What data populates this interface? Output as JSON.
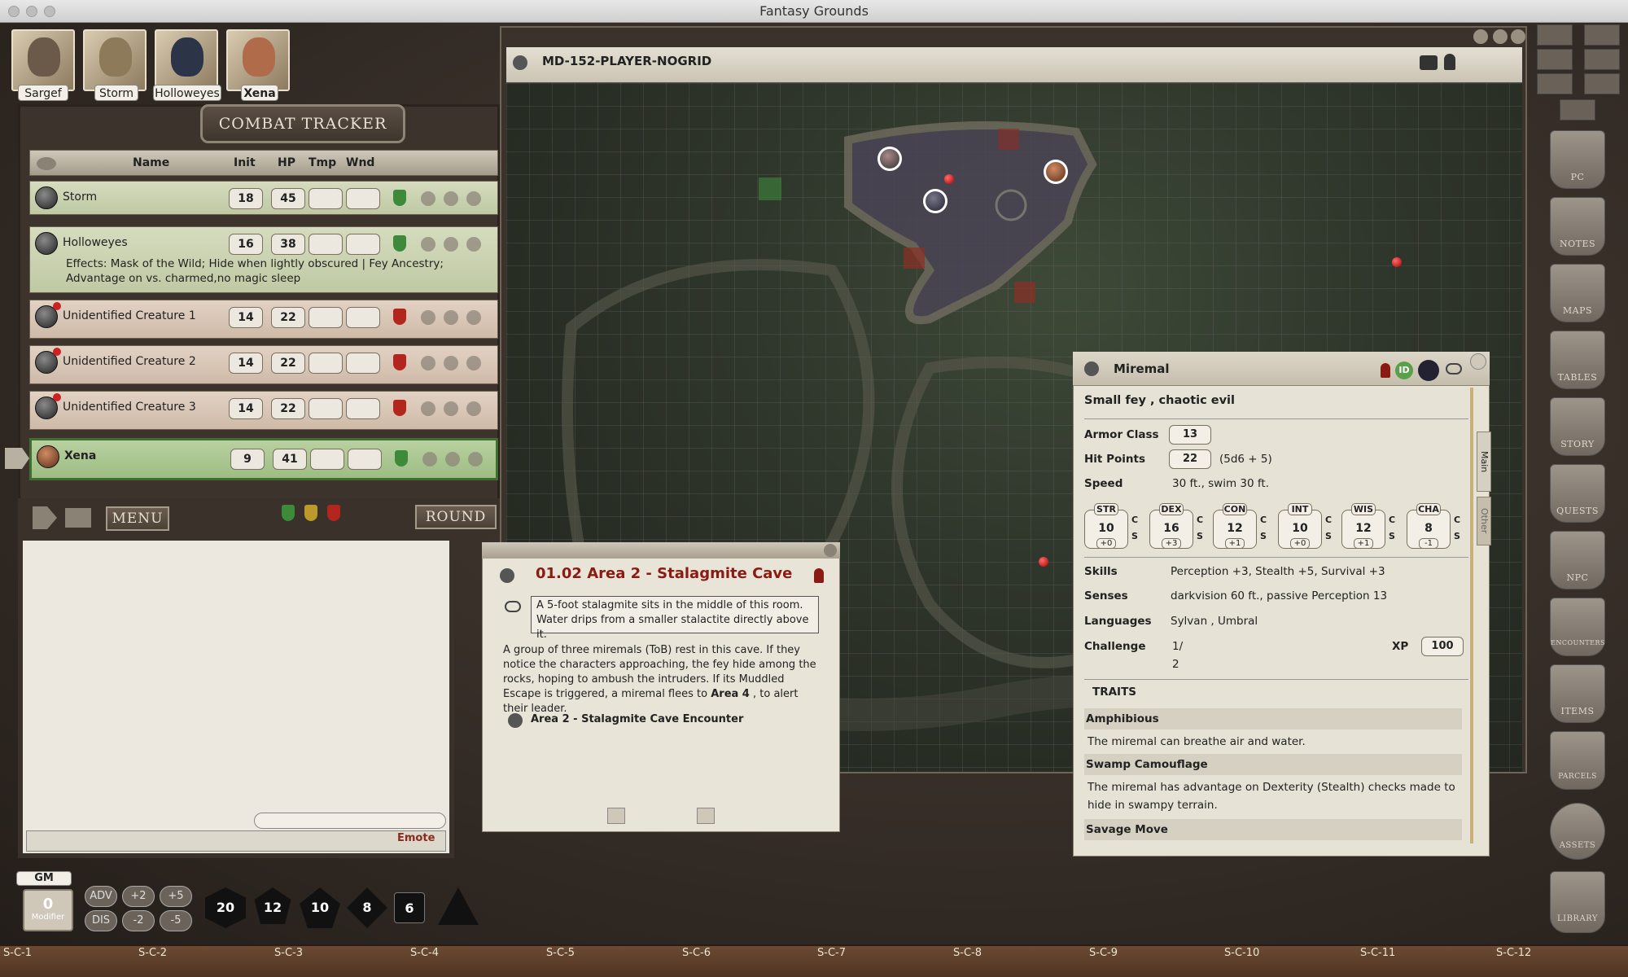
{
  "app": {
    "title": "Fantasy Grounds"
  },
  "portraits": [
    {
      "name": "Sargef"
    },
    {
      "name": "Storm"
    },
    {
      "name": "Holloweyes"
    },
    {
      "name": "Xena"
    }
  ],
  "combat_tracker": {
    "title": "COMBAT TRACKER",
    "headers": {
      "name": "Name",
      "init": "Init",
      "hp": "HP",
      "tmp": "Tmp",
      "wnd": "Wnd"
    },
    "rows": [
      {
        "name": "Storm",
        "init": "18",
        "hp": "45",
        "faction": "friend"
      },
      {
        "name": "Holloweyes",
        "init": "16",
        "hp": "38",
        "faction": "friend",
        "effects": "Effects: Mask of the Wild; Hide when lightly obscured | Fey Ancestry; Advantage on vs. charmed,no magic sleep"
      },
      {
        "name": "Unidentified Creature 1",
        "init": "14",
        "hp": "22",
        "faction": "foe"
      },
      {
        "name": "Unidentified Creature 2",
        "init": "14",
        "hp": "22",
        "faction": "foe"
      },
      {
        "name": "Unidentified Creature 3",
        "init": "14",
        "hp": "22",
        "faction": "foe"
      },
      {
        "name": "Xena",
        "init": "9",
        "hp": "41",
        "faction": "friend",
        "active": true
      }
    ],
    "menu_label": "MENU",
    "round_label": "ROUND"
  },
  "chat": {
    "emote_label": "Emote"
  },
  "dice_bar": {
    "gm_label": "GM",
    "modifier_value": "0",
    "modifier_label": "Modifier",
    "buttons": [
      "ADV",
      "+2",
      "+5",
      "DIS",
      "-2",
      "-5"
    ],
    "dice": [
      "20",
      "12",
      "10",
      "8",
      "6"
    ]
  },
  "map": {
    "title": "MD-152-PLAYER-NOGRID"
  },
  "story": {
    "title": "01.02 Area 2 - Stalagmite Cave",
    "boxed_text": "A 5-foot stalagmite sits in the middle of this room. Water drips from a smaller stalactite directly above it.",
    "body_1": "A group of three miremals (ToB) rest in this cave. If they notice the characters approaching, the fey hide among the rocks, hoping to ambush the intruders. If its Muddled Escape is triggered, a miremal flees to ",
    "body_bold": "Area 4",
    "body_2": " , to alert their leader.",
    "link": "Area 2 - Stalagmite Cave Encounter"
  },
  "npc": {
    "name": "Miremal",
    "type": "Small fey , chaotic evil",
    "armor_class_label": "Armor Class",
    "armor_class": "13",
    "hit_points_label": "Hit Points",
    "hit_points": "22",
    "hit_dice": "(5d6 + 5)",
    "speed_label": "Speed",
    "speed": "30 ft., swim 30 ft.",
    "abilities": [
      {
        "name": "STR",
        "value": "10",
        "mod": "+0"
      },
      {
        "name": "DEX",
        "value": "16",
        "mod": "+3"
      },
      {
        "name": "CON",
        "value": "12",
        "mod": "+1"
      },
      {
        "name": "INT",
        "value": "10",
        "mod": "+0"
      },
      {
        "name": "WIS",
        "value": "12",
        "mod": "+1"
      },
      {
        "name": "CHA",
        "value": "8",
        "mod": "-1"
      }
    ],
    "save_c": "C",
    "save_s": "S",
    "skills_label": "Skills",
    "skills": "Perception +3, Stealth +5, Survival +3",
    "senses_label": "Senses",
    "senses": "darkvision 60 ft., passive Perception 13",
    "languages_label": "Languages",
    "languages": "Sylvan , Umbral",
    "challenge_label": "Challenge",
    "challenge_1": "1/",
    "challenge_2": "2",
    "xp_label": "XP",
    "xp": "100",
    "traits_label": "TRAITS",
    "traits": [
      {
        "name": "Amphibious",
        "text": "The miremal can breathe air and water."
      },
      {
        "name": "Swamp Camouflage",
        "text": "The miremal has advantage on Dexterity (Stealth) checks made to hide in swampy terrain."
      },
      {
        "name": "Savage Move",
        "text": ""
      }
    ],
    "tab_main": "Main",
    "tab_other": "Other",
    "id_badge": "ID"
  },
  "sidebar": [
    "PC",
    "NOTES",
    "MAPS",
    "TABLES",
    "STORY",
    "QUESTS",
    "NPC",
    "ENCOUNTERS",
    "ITEMS",
    "PARCELS",
    "ASSETS",
    "LIBRARY"
  ],
  "hotkeys": [
    "S-C-1",
    "S-C-2",
    "S-C-3",
    "S-C-4",
    "S-C-5",
    "S-C-6",
    "S-C-7",
    "S-C-8",
    "S-C-9",
    "S-C-10",
    "S-C-11",
    "S-C-12"
  ],
  "colors": {
    "foe": "#b3261e",
    "friend": "#3c8a3a",
    "story_title": "#8a1b12"
  }
}
